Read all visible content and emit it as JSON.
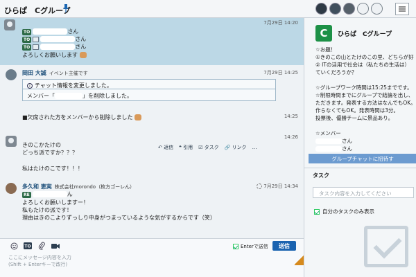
{
  "header": {
    "title": "ひらぱ　Cグループ",
    "icons": [
      "pin-icon",
      "member-avatar",
      "member-avatar",
      "member-avatar",
      "member-avatar",
      "member-avatar",
      "menu-icon"
    ]
  },
  "messages": {
    "m1": {
      "time": "7月29日 14:20",
      "to_label": "TO",
      "san": "さん",
      "closing": "よろしくお願いします"
    },
    "m2": {
      "name": "岡田 大誠",
      "role": "イベント主催です",
      "time": "7月29日 14:25",
      "info_title": "チャット情報を変更しました。",
      "member_prefix": "メンバー「",
      "member_suffix": "」を削除しました。"
    },
    "m3": {
      "text": "■欠席された方をメンバーから削除しました",
      "time": "14:25"
    },
    "actions": {
      "reply": "返信",
      "quote": "引用",
      "task": "タスク",
      "link": "リンク",
      "more": "…"
    },
    "m4": {
      "partial": "きのこかたけの",
      "line2": "どっち派ですか？？？",
      "line3": "私はたけのこです！！！",
      "time": "14:26"
    },
    "m5": {
      "name": "多久和 恵実",
      "company": "株式会社morondo（枚方ゴーレん）",
      "time": "7月29日 14:34",
      "re_label": "RE",
      "san": "ん",
      "line1": "よろしくお願いしますー！",
      "line2": "私もたけの派です！",
      "line3": "理由はきのこよりずっしり中身がつまっているような気がするからです（笑）"
    }
  },
  "composer": {
    "enter_send_label": "Enterで送信",
    "send_button": "送信",
    "placeholder": "ここにメッセージ内容を入力\n(Shift + Enterキーで改行)",
    "enter_send_checked": true
  },
  "panel": {
    "logo_letter": "C",
    "room_name": "ひらぱ　Cグループ",
    "description": [
      "☆お題！",
      "①きのこの山とたけのこの里、どちらが好",
      "② ITの活用で社会は（私たちの生活は）",
      "ていくだろうか？",
      "",
      "☆グループワーク時間は15:25までです。",
      "☆制限時間までにグループで結論を出し、",
      "ただきます。発表する方法はなんでもOK。",
      "作らなくてもOK。発表時間は3分。",
      "投票後、優勝チームに景品あり。",
      "",
      "☆メンバー"
    ],
    "member_suffix1": "さん",
    "member_suffix2": "さん",
    "invite_button": "グループチャットに招待す",
    "task_title": "タスク",
    "task_placeholder": "タスク内容を入力してください",
    "my_tasks_label": "自分のタスクのみ表示",
    "my_tasks_checked": true
  }
}
